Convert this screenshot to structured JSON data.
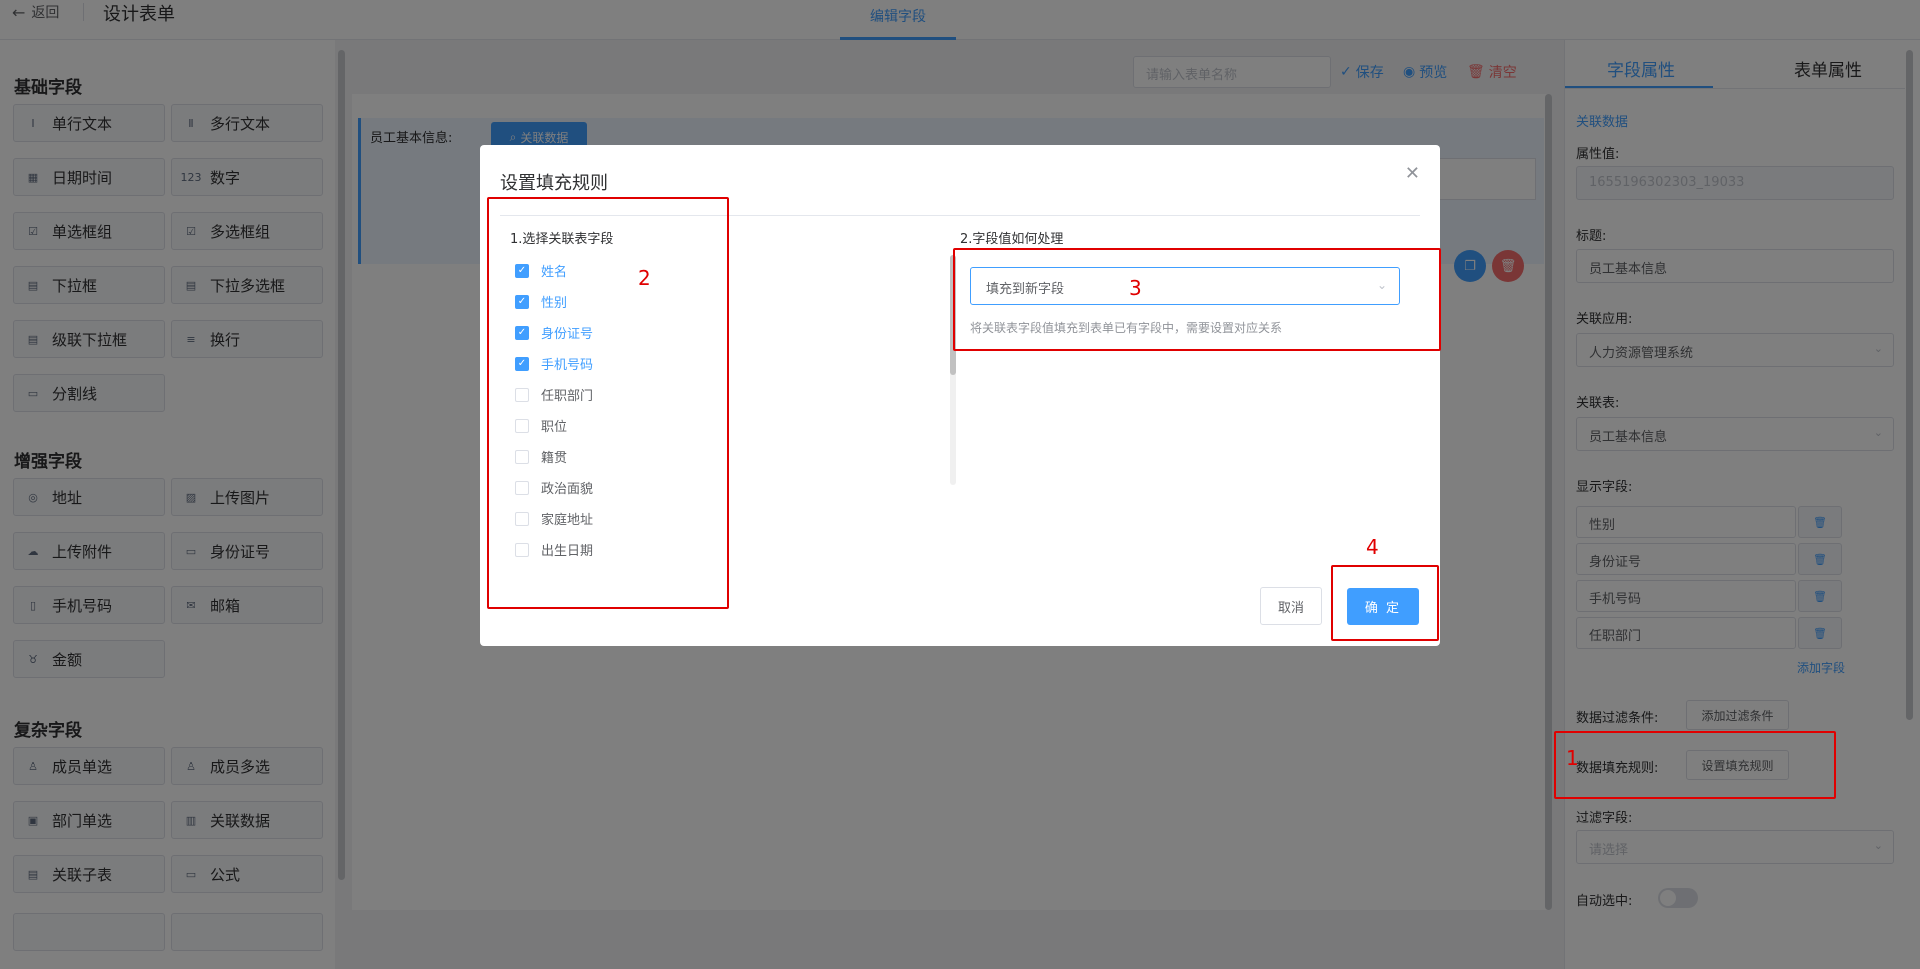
{
  "topbar": {
    "back_label": "返回",
    "title": "设计表单",
    "center_tab": "编辑字段"
  },
  "left": {
    "groups": [
      {
        "title": "基础字段",
        "items": [
          "单行文本",
          "多行文本",
          "日期时间",
          "数字",
          "单选框组",
          "多选框组",
          "下拉框",
          "下拉多选框",
          "级联下拉框",
          "换行",
          "分割线"
        ]
      },
      {
        "title": "增强字段",
        "items": [
          "地址",
          "上传图片",
          "上传附件",
          "身份证号",
          "手机号码",
          "邮箱",
          "金额"
        ]
      },
      {
        "title": "复杂字段",
        "items": [
          "成员单选",
          "成员多选",
          "部门单选",
          "关联数据",
          "关联子表",
          "公式"
        ]
      }
    ]
  },
  "toolbar": {
    "name_placeholder": "请输入表单名称",
    "save": "保存",
    "preview": "预览",
    "clear": "清空"
  },
  "canvas": {
    "row_label": "员工基本信息:",
    "related_button": "关联数据"
  },
  "right": {
    "tabs": [
      "字段属性",
      "表单属性"
    ],
    "field_type": "关联数据",
    "prop_value_label": "属性值:",
    "prop_value": "1655196302303_19033",
    "title_label": "标题:",
    "title_value": "员工基本信息",
    "app_label": "关联应用:",
    "app_value": "人力资源管理系统",
    "table_label": "关联表:",
    "table_value": "员工基本信息",
    "display_label": "显示字段:",
    "display_fields": [
      "性别",
      "身份证号",
      "手机号码",
      "任职部门"
    ],
    "add_field": "添加字段",
    "filter_label": "数据过滤条件:",
    "filter_button": "添加过滤条件",
    "fill_label": "数据填充规则:",
    "fill_button": "设置填充规则",
    "filter_field_label": "过滤字段:",
    "filter_field_placeholder": "请选择",
    "auto_select_label": "自动选中:"
  },
  "dialog": {
    "title": "设置填充规则",
    "col1_title": "1.选择关联表字段",
    "col2_title": "2.字段值如何处理",
    "fields": [
      {
        "label": "姓名",
        "checked": true
      },
      {
        "label": "性别",
        "checked": true
      },
      {
        "label": "身份证号",
        "checked": true
      },
      {
        "label": "手机号码",
        "checked": true
      },
      {
        "label": "任职部门",
        "checked": false
      },
      {
        "label": "职位",
        "checked": false
      },
      {
        "label": "籍贯",
        "checked": false
      },
      {
        "label": "政治面貌",
        "checked": false
      },
      {
        "label": "家庭地址",
        "checked": false
      },
      {
        "label": "出生日期",
        "checked": false
      }
    ],
    "select_value": "填充到新字段",
    "hint": "将关联表字段值填充到表单已有字段中，需要设置对应关系",
    "cancel": "取消",
    "ok": "确 定"
  },
  "annotations": [
    "1",
    "2",
    "3",
    "4"
  ],
  "colors": {
    "primary": "#409eff",
    "danger": "#f56c6c",
    "annotation": "#e00000"
  }
}
